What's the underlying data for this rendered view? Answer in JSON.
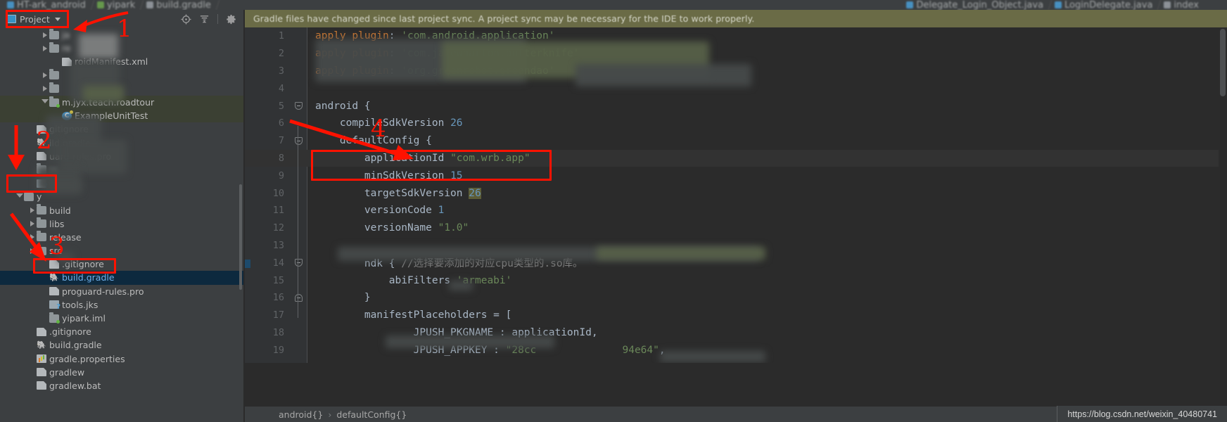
{
  "window": {
    "tabs": [
      {
        "label": "HT-ark_android",
        "icon": "android-module-icon"
      },
      {
        "label": "yipark",
        "icon": "module-icon"
      },
      {
        "label": "build.gradle",
        "icon": "gradle-icon"
      }
    ],
    "right_tabs": [
      {
        "label": "Delegate_Login_Object.java",
        "icon": "java-class-icon"
      },
      {
        "label": "LoginDelegate.java",
        "icon": "java-class-icon"
      },
      {
        "label": "index",
        "icon": "file-icon"
      }
    ]
  },
  "project_panel": {
    "title": "Project",
    "toolbar": {
      "locate_icon": "target-icon",
      "collapse_icon": "collapse-all-icon",
      "settings_icon": "gear-icon"
    },
    "tree": [
      {
        "label": "ja",
        "type": "folder",
        "indent": 3,
        "arrow": "collapsed",
        "blurred": true
      },
      {
        "label": "re",
        "type": "folder",
        "indent": 3,
        "arrow": "collapsed",
        "blurred": true
      },
      {
        "label": "roidManifest.xml",
        "type": "file",
        "indent": 4,
        "arrow": "none",
        "blurred": false
      },
      {
        "label": "",
        "type": "folder",
        "indent": 3,
        "arrow": "collapsed",
        "blurred": true
      },
      {
        "label": "",
        "type": "folder",
        "indent": 3,
        "arrow": "collapsed",
        "blurred": true
      },
      {
        "label": "m.jyx.teach.roadtour",
        "type": "package",
        "indent": 3,
        "arrow": "expanded",
        "highlight": "green"
      },
      {
        "label": "ExampleUnitTest",
        "type": "junit",
        "indent": 4,
        "arrow": "none",
        "highlight": "green"
      },
      {
        "label": "gitignore",
        "type": "file",
        "indent": 2,
        "arrow": "none"
      },
      {
        "label": "ild.gradle",
        "type": "gradle",
        "indent": 2,
        "arrow": "none"
      },
      {
        "label": "uard-rules.pro",
        "type": "file",
        "indent": 2,
        "arrow": "none"
      },
      {
        "label": "re",
        "type": "folder",
        "indent": 2,
        "arrow": "none",
        "blurred": true
      },
      {
        "label": "tools.j",
        "type": "jks",
        "indent": 2,
        "arrow": "none",
        "blurred": true
      },
      {
        "label": "y",
        "type": "folder",
        "indent": 1,
        "arrow": "expanded"
      },
      {
        "label": "build",
        "type": "folder",
        "indent": 2,
        "arrow": "collapsed"
      },
      {
        "label": "libs",
        "type": "folder",
        "indent": 2,
        "arrow": "collapsed"
      },
      {
        "label": "release",
        "type": "folder",
        "indent": 2,
        "arrow": "collapsed"
      },
      {
        "label": "src",
        "type": "folder",
        "indent": 2,
        "arrow": "collapsed"
      },
      {
        "label": ".gitignore",
        "type": "file",
        "indent": 3,
        "arrow": "none"
      },
      {
        "label": "build.gradle",
        "type": "gradle",
        "indent": 3,
        "arrow": "none",
        "selected": true
      },
      {
        "label": "proguard-rules.pro",
        "type": "file",
        "indent": 3,
        "arrow": "none"
      },
      {
        "label": "tools.jks",
        "type": "jks",
        "indent": 3,
        "arrow": "none"
      },
      {
        "label": "yipark.iml",
        "type": "folder-dot",
        "indent": 3,
        "arrow": "none"
      },
      {
        "label": ".gitignore",
        "type": "file",
        "indent": 2,
        "arrow": "none"
      },
      {
        "label": "build.gradle",
        "type": "gradle",
        "indent": 2,
        "arrow": "none"
      },
      {
        "label": "gradle.properties",
        "type": "props",
        "indent": 2,
        "arrow": "none"
      },
      {
        "label": "gradlew",
        "type": "file",
        "indent": 2,
        "arrow": "none"
      },
      {
        "label": "gradlew.bat",
        "type": "file",
        "indent": 2,
        "arrow": "none"
      }
    ]
  },
  "notification": {
    "message": "Gradle files have changed since last project sync. A project sync may be necessary for the IDE to work properly."
  },
  "editor": {
    "lines": [
      {
        "n": "1",
        "text": "apply plugin: 'com.android.application'",
        "blurred_overlay": true
      },
      {
        "n": "2",
        "text": "apply plugin: 'com.jakewharton.butterknife'",
        "blurred_overlay": true
      },
      {
        "n": "3",
        "text": "apply plugin: 'org.greenrobot.greendao'",
        "blurred_overlay": true
      },
      {
        "n": "4",
        "text": ""
      },
      {
        "n": "5",
        "text": "android {",
        "fold": "down"
      },
      {
        "n": "6",
        "text": "    compileSdkVersion 26"
      },
      {
        "n": "7",
        "text": "    defaultConfig {",
        "fold": "down"
      },
      {
        "n": "8",
        "text": "        applicationId \"com.wrb.app\"",
        "bulb": true,
        "current": true
      },
      {
        "n": "9",
        "text": "        minSdkVersion 15"
      },
      {
        "n": "10",
        "text": "        targetSdkVersion 26",
        "highlight_token": "26"
      },
      {
        "n": "11",
        "text": "        versionCode 1"
      },
      {
        "n": "12",
        "text": "        versionName \"1.0\""
      },
      {
        "n": "13",
        "text": "",
        "blurred_overlay": true
      },
      {
        "n": "14",
        "text": "        ndk { //选择要添加的对应cpu类型的.so库。",
        "fold": "down"
      },
      {
        "n": "15",
        "text": "            abiFilters 'armeabi'"
      },
      {
        "n": "16",
        "text": "        }",
        "fold": "up"
      },
      {
        "n": "17",
        "text": "        manifestPlaceholders = ["
      },
      {
        "n": "18",
        "text": "                JPUSH_PKGNAME : applicationId,",
        "blurred_overlay": true
      },
      {
        "n": "19",
        "text": "                JPUSH_APPKEY : \"28cc              94e64\","
      }
    ]
  },
  "statusbar": {
    "breadcrumb": [
      "android{}",
      "defaultConfig{}"
    ],
    "separator": "›",
    "watermark": "https://blog.csdn.net/weixin_40480741"
  },
  "annotations": [
    {
      "id": "1",
      "label": "1"
    },
    {
      "id": "2",
      "label": "2"
    },
    {
      "id": "3",
      "label": "3"
    },
    {
      "id": "4",
      "label": "4"
    }
  ],
  "colors": {
    "annotation_red": "#ff1200",
    "selection_blue": "#0d293e",
    "notification_olive": "#6a6b46",
    "panel_bg": "#3c3f41",
    "editor_bg": "#2b2b2b"
  }
}
